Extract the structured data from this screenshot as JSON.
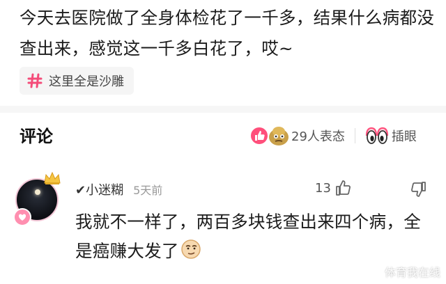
{
  "post": {
    "text": "今天去医院做了全身体检花了一千多，结果什么病都没查出来，感觉这一千多白花了，哎~",
    "topic": "这里全是沙雕"
  },
  "comments_section": {
    "title": "评论",
    "reactions_count": "29人表态",
    "eyes_label": "插眼"
  },
  "comment": {
    "username": "✔小迷糊",
    "time": "5天前",
    "like_count": "13",
    "text": "我就不一样了，两百多块钱查出来四个病，全是癌赚大发了"
  },
  "watermark": "体育我在线",
  "colors": {
    "accent": "#ff4f7b",
    "hash": "#f44c79"
  },
  "icons": [
    "hash-icon",
    "like-reaction-icon",
    "face-reaction-icon",
    "eyes-icon",
    "crown-icon",
    "badge-icon",
    "verified-icon",
    "thumbs-up-icon",
    "thumbs-down-icon",
    "smirk-emoji-icon"
  ]
}
